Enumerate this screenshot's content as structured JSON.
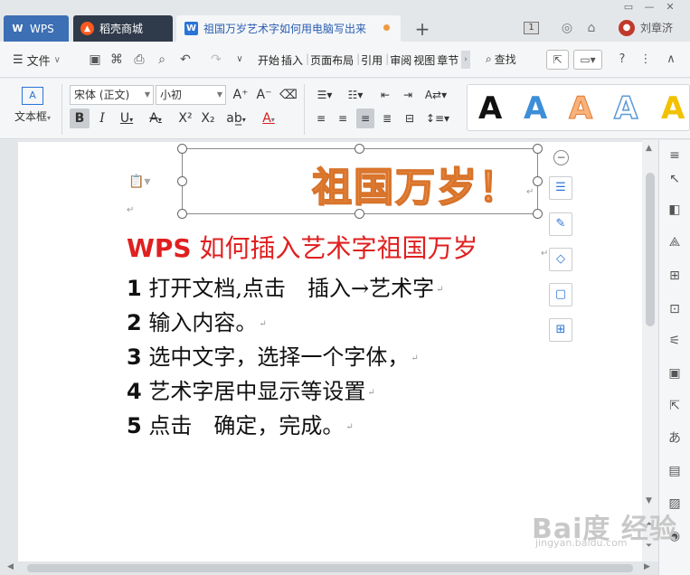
{
  "tabs": {
    "wps": "WPS",
    "store": "稻壳商城",
    "doc": "祖国万岁艺术字如何用电脑写出来",
    "new_tab": "+"
  },
  "titlebar": {
    "badge": "1",
    "username": "刘章济"
  },
  "menubar": {
    "file": "文件",
    "items": [
      "开始",
      "插入",
      "页面布局",
      "引用",
      "审阅",
      "视图",
      "章节"
    ],
    "search": "查找"
  },
  "ribbon": {
    "textbox_label": "文本框",
    "font_name": "宋体 (正文)",
    "font_size": "小初",
    "style_letter": "A"
  },
  "document": {
    "art_text": "祖国万岁！",
    "heading_prefix": "WPS",
    "heading_rest": " 如何插入艺术字祖国万岁",
    "lines": [
      {
        "num": "1",
        "text": " 打开文档,点击　插入→艺术字"
      },
      {
        "num": "2",
        "text": " 输入内容。"
      },
      {
        "num": "3",
        "text": " 选中文字，选择一个字体，"
      },
      {
        "num": "4",
        "text": " 艺术字居中显示等设置"
      },
      {
        "num": "5",
        "text": " 点击　确定，完成。"
      }
    ]
  },
  "watermark": {
    "logo": "Bai度 经验",
    "url": "jingyan.baidu.com"
  },
  "colors": {
    "accent": "#2a74d8",
    "heading_red": "#e02020",
    "art_orange": "#f5a15c",
    "wps_tab": "#3c6fb4",
    "store_tab": "#2f3a4a"
  }
}
